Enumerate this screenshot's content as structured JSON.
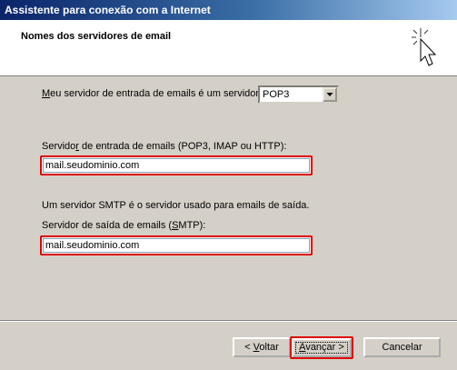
{
  "window": {
    "title": "Assistente para conexão com a Internet"
  },
  "header": {
    "title": "Nomes dos servidores de email",
    "icon": "sparkle-cursor-icon"
  },
  "incoming_type": {
    "label_first": "M",
    "label_rest": "eu servidor de entrada de emails é um  servidor",
    "selected": "POP3"
  },
  "incoming_server": {
    "label_prefix": "Servido",
    "label_accel": "r",
    "label_rest": " de entrada de emails (POP3, IMAP ou HTTP):",
    "value": "mail.seudominio.com"
  },
  "smtp_note": "Um servidor SMTP é o servidor usado para emails de saída.",
  "outgoing_server": {
    "label_prefix": "Servidor de saída de emails (",
    "label_accel": "S",
    "label_rest": "MTP):",
    "value": "mail.seudominio.com"
  },
  "buttons": {
    "back_prefix": "< ",
    "back_accel": "V",
    "back_rest": "oltar",
    "next_accel": "A",
    "next_rest": "vançar >",
    "cancel": "Cancelar"
  }
}
